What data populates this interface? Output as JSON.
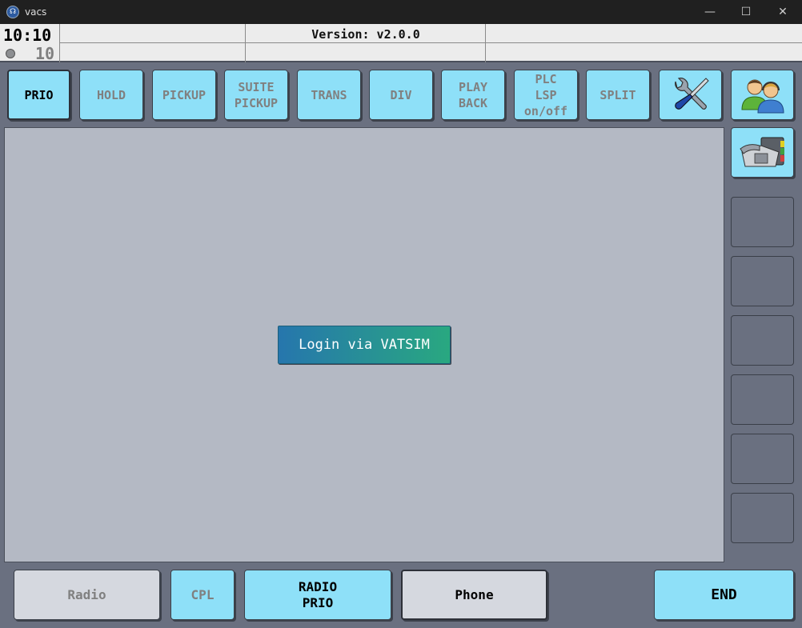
{
  "window": {
    "title": "vacs",
    "minimize": "—",
    "maximize": "☐",
    "close": "✕"
  },
  "status": {
    "clock": "10:10",
    "counter": "10",
    "version": "Version: v2.0.0"
  },
  "toolbar": {
    "prio": "PRIO",
    "hold": "HOLD",
    "pickup": "PICKUP",
    "suite_pickup": "SUITE\nPICKUP",
    "trans": "TRANS",
    "div": "DIV",
    "play_back": "PLAY\nBACK",
    "plc_lsp": "PLC\nLSP\non/off",
    "split": "SPLIT"
  },
  "main": {
    "login_label": "Login via VATSIM"
  },
  "bottom": {
    "radio": "Radio",
    "cpl": "CPL",
    "radio_prio": "RADIO\nPRIO",
    "phone": "Phone",
    "end": "END"
  },
  "icons": {
    "settings": "tools-icon",
    "users": "users-icon",
    "phonebook": "phonebook-icon"
  },
  "colors": {
    "button_bg": "#8ee0f8",
    "panel_bg": "#b4b9c4",
    "frame_bg": "#6a7080",
    "login_gradient_start": "#2676ad",
    "login_gradient_end": "#29a880"
  }
}
